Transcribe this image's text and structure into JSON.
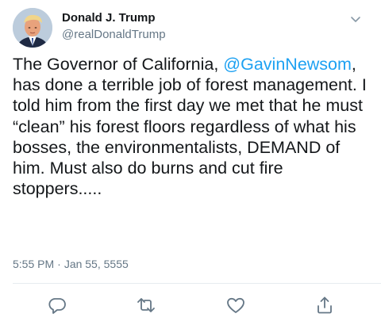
{
  "author": {
    "display_name": "Donald J. Trump",
    "handle": "@realDonaldTrump"
  },
  "tweet": {
    "text_before_mention": "The Governor of California, ",
    "mention": "@GavinNewsom",
    "text_after_mention": ", has done a terrible job of forest management. I told him from the first day we met that he must “clean” his forest floors regardless of what his bosses, the environmentalists, DEMAND of him. Must also do burns and cut fire stoppers....."
  },
  "meta": {
    "time": "5:55 PM",
    "separator": "·",
    "date": "Jan 55, 5555"
  },
  "actions": {
    "reply_icon": "reply-icon",
    "retweet_icon": "retweet-icon",
    "like_icon": "heart-icon",
    "share_icon": "share-icon"
  },
  "colors": {
    "link": "#1da1f2",
    "secondary_text": "#657786",
    "primary_text": "#14171a",
    "divider": "#e6ecf0"
  }
}
